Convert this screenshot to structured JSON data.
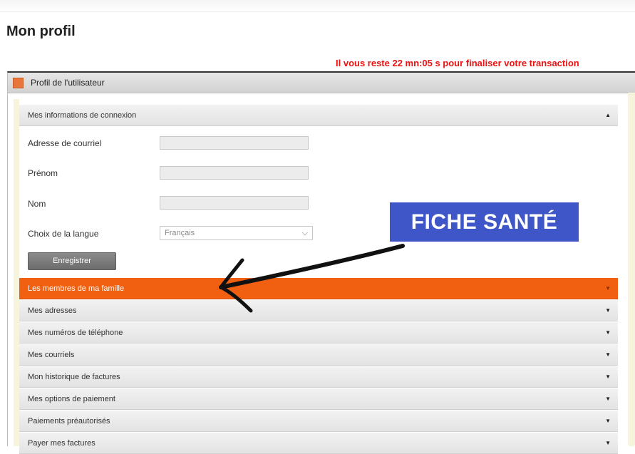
{
  "page": {
    "title": "Mon profil",
    "timer_text": "Il vous reste 22 mn:05 s pour finaliser votre transaction"
  },
  "panel": {
    "title": "Profil de l'utilisateur"
  },
  "connection_section": {
    "header": "Mes informations de connexion",
    "arrow": "▲",
    "fields": [
      {
        "label": "Adresse de courriel",
        "value": ""
      },
      {
        "label": "Prénom",
        "value": ""
      },
      {
        "label": "Nom",
        "value": ""
      }
    ],
    "language": {
      "label": "Choix de la langue",
      "selected": "Français",
      "chevron": "⌵"
    },
    "save_label": "Enregistrer"
  },
  "sections": [
    {
      "label": "Les membres de ma famille",
      "arrow": "▼",
      "active": true
    },
    {
      "label": "Mes adresses",
      "arrow": "▼"
    },
    {
      "label": "Mes numéros de téléphone",
      "arrow": "▼"
    },
    {
      "label": "Mes courriels",
      "arrow": "▼"
    },
    {
      "label": "Mon historique de factures",
      "arrow": "▼"
    },
    {
      "label": "Mes options de paiement",
      "arrow": "▼"
    },
    {
      "label": "Paiements préautorisés",
      "arrow": "▼"
    },
    {
      "label": "Payer mes factures",
      "arrow": "▼"
    }
  ],
  "annotation": {
    "label": "FICHE SANTÉ",
    "color": "#3f56c8",
    "arrow_icon": "hand-drawn-arrow-icon"
  },
  "colors": {
    "accent_orange": "#f06010",
    "timer_red": "#ee1111"
  }
}
